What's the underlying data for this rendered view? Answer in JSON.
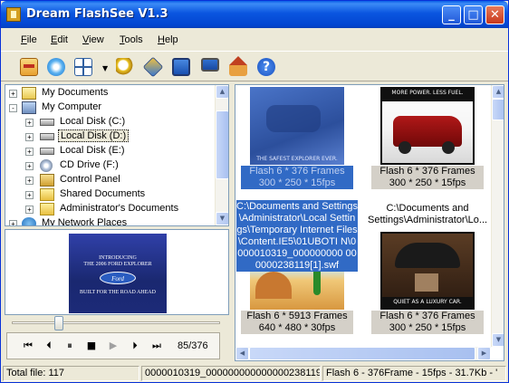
{
  "window": {
    "title": "Dream FlashSee V1.3"
  },
  "menu": [
    {
      "label": "File",
      "key": "F",
      "rest": "ile"
    },
    {
      "label": "Edit",
      "key": "E",
      "rest": "dit"
    },
    {
      "label": "View",
      "key": "V",
      "rest": "iew"
    },
    {
      "label": "Tools",
      "key": "T",
      "rest": "ools"
    },
    {
      "label": "Help",
      "key": "H",
      "rest": "elp"
    }
  ],
  "toolbar": {
    "icons": [
      "open-folder-icon",
      "capture-icon",
      "view-mode-icon",
      "find-icon",
      "extract-icon",
      "fullscreen-icon",
      "monitor-icon",
      "home-icon",
      "help-icon"
    ]
  },
  "tree": {
    "items": [
      {
        "label": "My Documents",
        "icon": "my-documents-icon",
        "expander": "+"
      },
      {
        "label": "My Computer",
        "icon": "my-computer-icon",
        "expander": "-"
      },
      {
        "label": "Local Disk (C:)",
        "icon": "drive-icon",
        "expander": "+"
      },
      {
        "label": "Local Disk (D:)",
        "icon": "drive-icon",
        "expander": "+",
        "selected": true
      },
      {
        "label": "Local Disk (E:)",
        "icon": "drive-icon",
        "expander": "+"
      },
      {
        "label": "CD Drive (F:)",
        "icon": "cd-drive-icon",
        "expander": "+"
      },
      {
        "label": "Control Panel",
        "icon": "control-panel-icon",
        "expander": "+"
      },
      {
        "label": "Shared Documents",
        "icon": "folder-icon",
        "expander": "+"
      },
      {
        "label": "Administrator's Documents",
        "icon": "folder-icon",
        "expander": "+"
      },
      {
        "label": "My Network Places",
        "icon": "network-icon",
        "expander": "+"
      }
    ]
  },
  "preview": {
    "line1": "INTRODUCING",
    "line2": "THE 2006 FORD EXPLORER",
    "logo": "Ford",
    "tagline": "BUILT FOR THE ROAD AHEAD"
  },
  "player": {
    "frame_display": "85/376",
    "position_fraction": 0.226
  },
  "thumbnails": [
    {
      "caption1": "Flash 6 * 376 Frames",
      "caption2": "300 * 250 * 15fps",
      "image_text": "THE SAFEST EXPLORER EVER.",
      "selected": true
    },
    {
      "caption1": "Flash 6 * 376 Frames",
      "caption2": "300 * 250 * 15fps",
      "image_text": "MORE POWER. LESS FUEL.",
      "name1": "C:\\Documents and",
      "name2": "Settings\\Administrator\\Lo..."
    },
    {
      "caption1": "Flash 6 * 5913 Frames",
      "caption2": "640 * 480 * 30fps"
    },
    {
      "caption1": "Flash 6 * 376 Frames",
      "caption2": "300 * 250 * 15fps",
      "image_text": "QUIET AS A LUXURY CAR."
    }
  ],
  "tooltip": {
    "text": "C:\\Documents and Settings\\Administrator\\Local Settings\\Temporary Internet Files\\Content.IE5\\01UBOTI N\\0000010319_000000000 000000238119[1].swf"
  },
  "status": {
    "total": "Total file: 117",
    "filename": "0000010319_000000000000000238119[",
    "info": "Flash 6 - 376Frame - 15fps - 31.7Kb - '"
  },
  "colors": {
    "title_bar": "#0a55e0",
    "selection": "#316ac5",
    "window_bg": "#ece9d8"
  }
}
